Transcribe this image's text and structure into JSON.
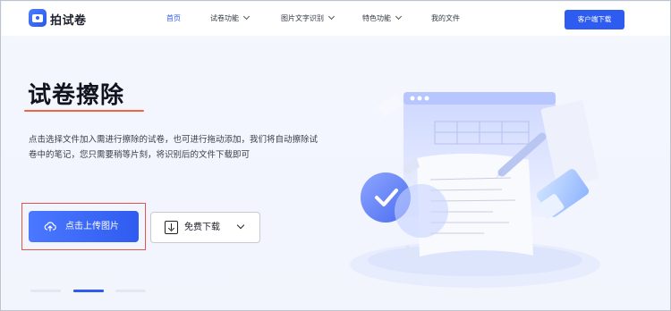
{
  "header": {
    "brand": "拍试卷",
    "nav": [
      {
        "label": "首页",
        "active": true,
        "dropdown": false
      },
      {
        "label": "试卷功能",
        "active": false,
        "dropdown": true
      },
      {
        "label": "图片文字识别",
        "active": false,
        "dropdown": true
      },
      {
        "label": "特色功能",
        "active": false,
        "dropdown": true
      },
      {
        "label": "我的文件",
        "active": false,
        "dropdown": false
      }
    ],
    "download_button": "客户端下载"
  },
  "hero": {
    "title": "试卷擦除",
    "description": "点击选择文件加入需进行擦除的试卷，也可进行拖动添加，我们将自动擦除试卷中的笔记，您只需要稍等片刻，将识别后的文件下载即可",
    "upload_button": "点击上传图片",
    "free_download_button": "免费下载"
  },
  "carousel": {
    "slides": 3,
    "active_index": 1
  },
  "colors": {
    "accent": "#2f5cf0",
    "underline": "#f0663a",
    "highlight": "#e2564a"
  },
  "icons": {
    "upload": "cloud-upload-icon",
    "download": "download-icon",
    "dropdown": "chevron-down-icon"
  }
}
